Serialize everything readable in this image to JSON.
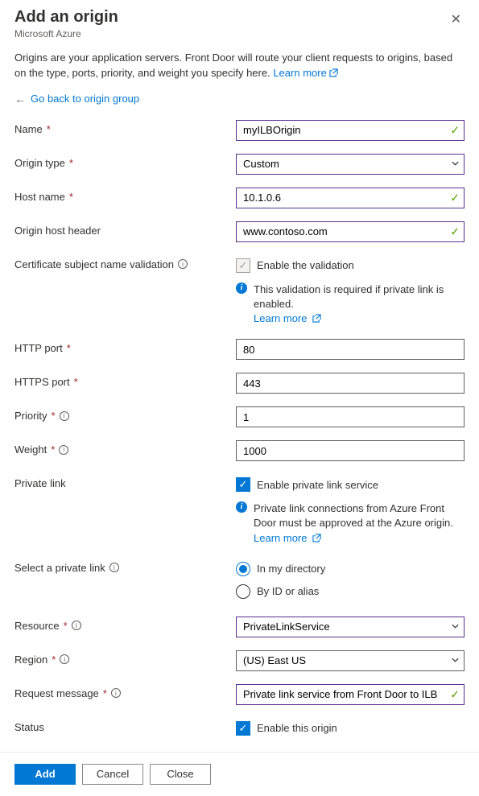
{
  "header": {
    "title": "Add an origin",
    "subtitle": "Microsoft Azure"
  },
  "description": {
    "text": "Origins are your application servers. Front Door will route your client requests to origins, based on the type, ports, priority, and weight you specify here. ",
    "learn_more": "Learn more"
  },
  "back_link": "Go back to origin group",
  "fields": {
    "name": {
      "label": "Name",
      "value": "myILBOrigin"
    },
    "origin_type": {
      "label": "Origin type",
      "value": "Custom"
    },
    "host_name": {
      "label": "Host name",
      "value": "10.1.0.6"
    },
    "origin_host_header": {
      "label": "Origin host header",
      "value": "www.contoso.com"
    },
    "cert_validation": {
      "label": "Certificate subject name validation",
      "checkbox_label": "Enable the validation",
      "note": "This validation is required if private link is enabled.",
      "learn_more": "Learn more"
    },
    "http_port": {
      "label": "HTTP port",
      "value": "80"
    },
    "https_port": {
      "label": "HTTPS port",
      "value": "443"
    },
    "priority": {
      "label": "Priority",
      "value": "1"
    },
    "weight": {
      "label": "Weight",
      "value": "1000"
    },
    "private_link": {
      "label": "Private link",
      "checkbox_label": "Enable private link service",
      "note": "Private link connections from Azure Front Door must be approved at the Azure origin.",
      "learn_more": "Learn more"
    },
    "select_private_link": {
      "label": "Select a private link",
      "option1": "In my directory",
      "option2": "By ID or alias"
    },
    "resource": {
      "label": "Resource",
      "value": "PrivateLinkService"
    },
    "region": {
      "label": "Region",
      "value": "(US) East US"
    },
    "request_message": {
      "label": "Request message",
      "value": "Private link service from Front Door to ILB"
    },
    "status": {
      "label": "Status",
      "checkbox_label": "Enable this origin"
    }
  },
  "buttons": {
    "add": "Add",
    "cancel": "Cancel",
    "close": "Close"
  }
}
